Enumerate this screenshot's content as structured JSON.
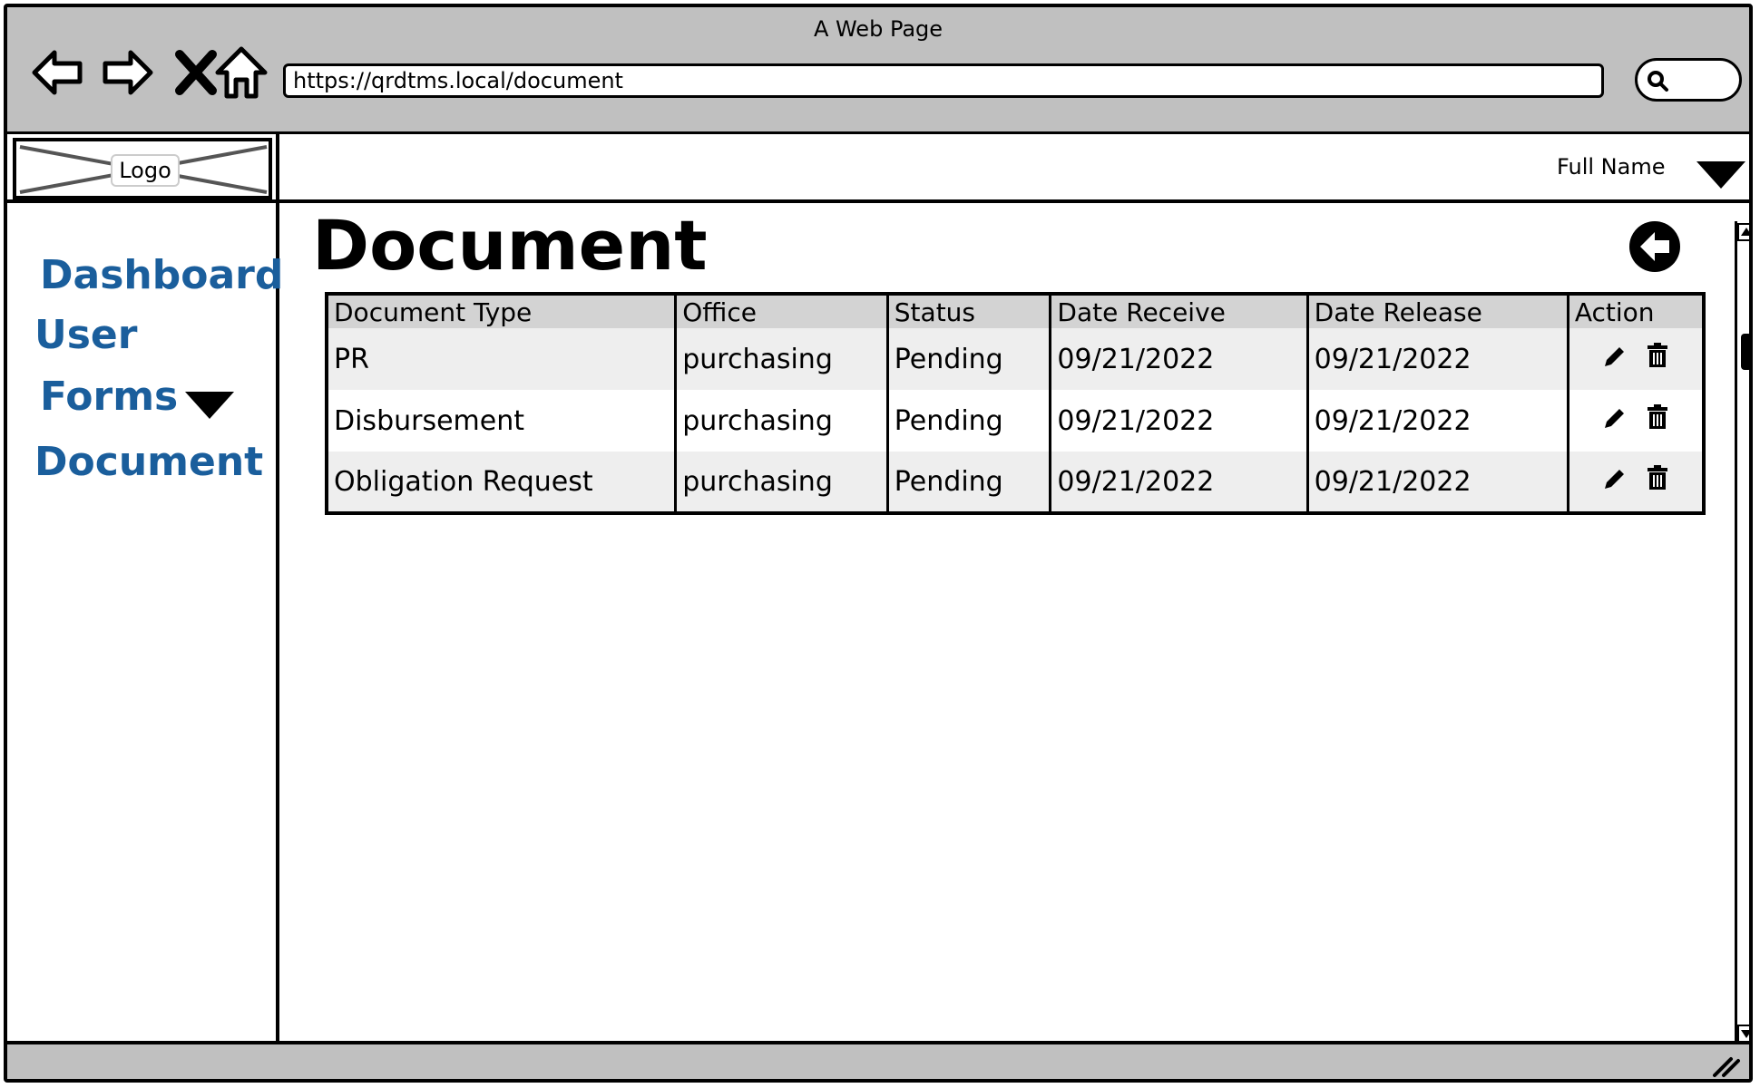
{
  "window": {
    "title": "A Web Page"
  },
  "browser": {
    "url": "https://qrdtms.local/document"
  },
  "sidebar": {
    "logo": "Logo",
    "items": [
      {
        "label": "Dashboard"
      },
      {
        "label": "User"
      },
      {
        "label": "Forms"
      },
      {
        "label": "Document"
      }
    ]
  },
  "topbar": {
    "user_name": "Full Name"
  },
  "main": {
    "title": "Document",
    "table": {
      "headers": [
        "Document Type",
        "Office",
        "Status",
        "Date Receive",
        "Date Release",
        "Action"
      ],
      "rows": [
        [
          "PR",
          "purchasing",
          "Pending",
          "09/21/2022",
          "09/21/2022"
        ],
        [
          "Disbursement",
          "purchasing",
          "Pending",
          "09/21/2022",
          "09/21/2022"
        ],
        [
          "Obligation Request",
          "purchasing",
          "Pending",
          "09/21/2022",
          "09/21/2022"
        ]
      ]
    }
  },
  "colors": {
    "accent": "#1a5e9c",
    "chrome": "#c0c0c0",
    "header_row": "#d3d3d3",
    "alt_row": "#eeeeee"
  }
}
